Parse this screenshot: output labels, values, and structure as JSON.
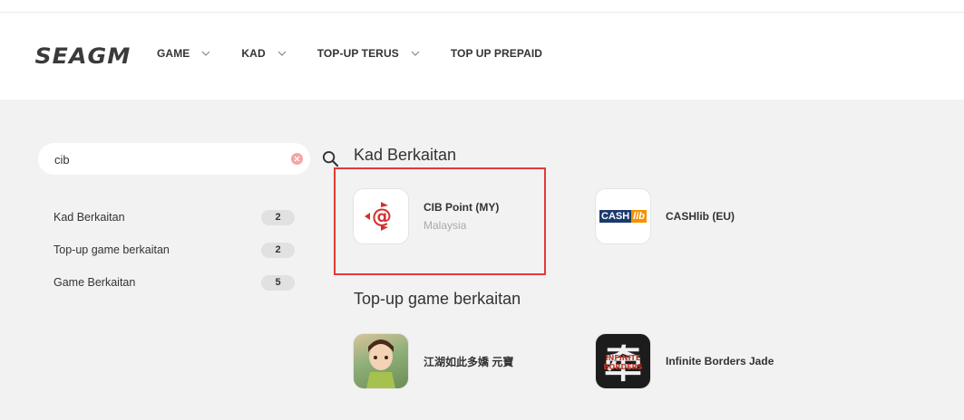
{
  "header": {
    "logo": "SEAGM",
    "nav": [
      {
        "label": "GAME",
        "has_dropdown": true
      },
      {
        "label": "KAD",
        "has_dropdown": true
      },
      {
        "label": "TOP-UP TERUS",
        "has_dropdown": true
      },
      {
        "label": "TOP UP PREPAID",
        "has_dropdown": false
      }
    ]
  },
  "search": {
    "value": "cib",
    "clear_icon": "clear-icon",
    "search_icon": "search-icon"
  },
  "filters": [
    {
      "label": "Kad Berkaitan",
      "count": "2"
    },
    {
      "label": "Top-up game berkaitan",
      "count": "2"
    },
    {
      "label": "Game Berkaitan",
      "count": "5"
    }
  ],
  "sections": {
    "cards": {
      "title": "Kad Berkaitan",
      "items": [
        {
          "name": "CIB Point (MY)",
          "subtitle": "Malaysia",
          "highlighted": true
        },
        {
          "name": "CASHlib (EU)",
          "subtitle": ""
        }
      ]
    },
    "topup": {
      "title": "Top-up game berkaitan",
      "items": [
        {
          "name": "江湖如此多嬌 元寶",
          "subtitle": ""
        },
        {
          "name": "Infinite Borders Jade",
          "subtitle": ""
        }
      ]
    }
  },
  "logos": {
    "cashlib_cash": "CASH",
    "cashlib_lib": "lib",
    "infinite_glyph": "牵",
    "infinite_text": "INFINITE BORDERS"
  },
  "colors": {
    "accent_red": "#e53935",
    "cib_red": "#d32f2f",
    "cashlib_blue": "#1b3a6b",
    "cashlib_orange": "#f39200"
  }
}
